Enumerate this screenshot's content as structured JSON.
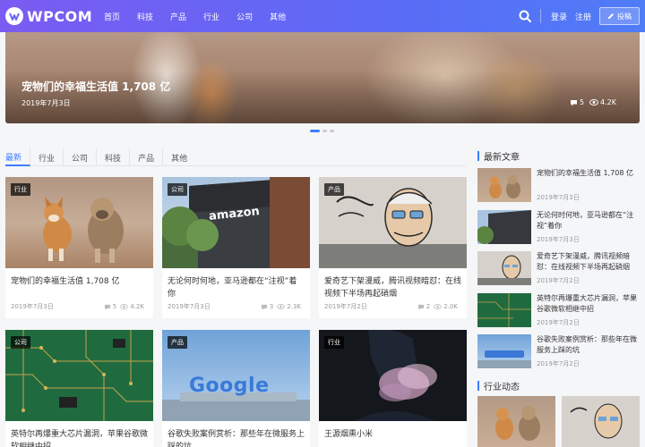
{
  "header": {
    "logo_text": "WPCOM",
    "nav": [
      "首页",
      "科技",
      "产品",
      "行业",
      "公司",
      "其他"
    ],
    "login": "登录",
    "register": "注册",
    "submit": "投稿",
    "brand_color": "#6a63f4"
  },
  "hero": {
    "title": "宠物们的幸福生活值 1,708 亿",
    "date": "2019年7月3日",
    "comments": "5",
    "views": "4.2K"
  },
  "tabs": [
    "最新",
    "行业",
    "公司",
    "科技",
    "产品",
    "其他"
  ],
  "cards": [
    {
      "badge": "行业",
      "title": "宠物们的幸福生活值 1,708 亿",
      "date": "2019年7月3日",
      "comments": "5",
      "views": "4.2K"
    },
    {
      "badge": "公司",
      "title": "无论何时何地，亚马逊都在“注视”着你",
      "date": "2019年7月3日",
      "comments": "3",
      "views": "2.3K"
    },
    {
      "badge": "产品",
      "title": "爱奇艺下架漫威，腾讯视频暗怼：在线视频下半场再起硝烟",
      "date": "2019年7月2日",
      "comments": "2",
      "views": "2.0K"
    },
    {
      "badge": "公司",
      "title": "英特尔再爆重大芯片漏洞，苹果谷歌微软相继中招"
    },
    {
      "badge": "产品",
      "title": "谷歌失败案例赏析：那些年在微服务上踩的坑"
    },
    {
      "badge": "行业",
      "title": "王源烟熏小米"
    }
  ],
  "sidebar": {
    "latest_heading": "最新文章",
    "latest": [
      {
        "title": "宠物们的幸福生活值 1,708 亿",
        "date": "2019年7月3日"
      },
      {
        "title": "无论何时何地，亚马逊都在“注视”着你",
        "date": "2019年7月3日"
      },
      {
        "title": "爱奇艺下架漫威，腾讯视频暗怼：在线视频下半场再起硝烟",
        "date": "2019年7月2日"
      },
      {
        "title": "英特尔再爆重大芯片漏洞，苹果谷歌微软相继中招",
        "date": "2019年7月2日"
      },
      {
        "title": "谷歌失败案例赏析：那些年在微服务上踩的坑",
        "date": "2019年7月2日"
      }
    ],
    "industry_heading": "行业动态"
  },
  "images": {
    "amazon_sign": "amazon",
    "google_sign": "Google"
  }
}
